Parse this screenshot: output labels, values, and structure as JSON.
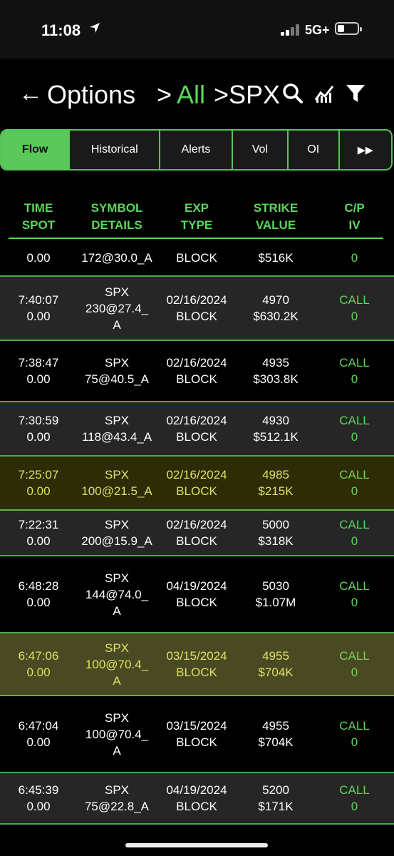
{
  "status_bar": {
    "time": "11:08",
    "network": "5G+"
  },
  "header": {
    "back": "←",
    "crumb1": "Options",
    "sep1": ">",
    "crumb2": "All",
    "sep2": ">SPX"
  },
  "tabs": [
    {
      "label": "Flow",
      "active": true
    },
    {
      "label": "Historical",
      "active": false
    },
    {
      "label": "Alerts",
      "active": false
    },
    {
      "label": "Vol",
      "active": false
    },
    {
      "label": "OI",
      "active": false
    },
    {
      "label": "▸▸",
      "active": false
    }
  ],
  "columns": [
    {
      "line1": "TIME",
      "line2": "SPOT"
    },
    {
      "line1": "SYMBOL",
      "line2": "DETAILS"
    },
    {
      "line1": "EXP",
      "line2": "TYPE"
    },
    {
      "line1": "STRIKE",
      "line2": "VALUE"
    },
    {
      "line1": "C/P",
      "line2": "IV"
    }
  ],
  "rows": [
    {
      "time": "",
      "spot": "0.00",
      "symbol": "",
      "details": "172@30.0_A",
      "exp": "",
      "type": "BLOCK",
      "strike": "",
      "value": "$516K",
      "cp": "",
      "iv": "0",
      "highlight": false
    },
    {
      "time": "7:40:07",
      "spot": "0.00",
      "symbol": "SPX",
      "details": "230@27.4_ A",
      "exp": "02/16/2024",
      "type": "BLOCK",
      "strike": "4970",
      "value": "$630.2K",
      "cp": "CALL",
      "iv": "0",
      "highlight": false
    },
    {
      "time": "7:38:47",
      "spot": "0.00",
      "symbol": "SPX",
      "details": "75@40.5_A",
      "exp": "02/16/2024",
      "type": "BLOCK",
      "strike": "4935",
      "value": "$303.8K",
      "cp": "CALL",
      "iv": "0",
      "highlight": false
    },
    {
      "time": "7:30:59",
      "spot": "0.00",
      "symbol": "SPX",
      "details": "118@43.4_A",
      "exp": "02/16/2024",
      "type": "BLOCK",
      "strike": "4930",
      "value": "$512.1K",
      "cp": "CALL",
      "iv": "0",
      "highlight": false
    },
    {
      "time": "7:25:07",
      "spot": "0.00",
      "symbol": "SPX",
      "details": "100@21.5_A",
      "exp": "02/16/2024",
      "type": "BLOCK",
      "strike": "4985",
      "value": "$215K",
      "cp": "CALL",
      "iv": "0",
      "highlight": true
    },
    {
      "time": "7:22:31",
      "spot": "0.00",
      "symbol": "SPX",
      "details": "200@15.9_A",
      "exp": "02/16/2024",
      "type": "BLOCK",
      "strike": "5000",
      "value": "$318K",
      "cp": "CALL",
      "iv": "0",
      "highlight": false
    },
    {
      "time": "6:48:28",
      "spot": "0.00",
      "symbol": "SPX",
      "details": "144@74.0_ A",
      "exp": "04/19/2024",
      "type": "BLOCK",
      "strike": "5030",
      "value": "$1.07M",
      "cp": "CALL",
      "iv": "0",
      "highlight": false
    },
    {
      "time": "6:47:06",
      "spot": "0.00",
      "symbol": "SPX",
      "details": "100@70.4_ A",
      "exp": "03/15/2024",
      "type": "BLOCK",
      "strike": "4955",
      "value": "$704K",
      "cp": "CALL",
      "iv": "0",
      "highlight": true
    },
    {
      "time": "6:47:04",
      "spot": "0.00",
      "symbol": "SPX",
      "details": "100@70.4_ A",
      "exp": "03/15/2024",
      "type": "BLOCK",
      "strike": "4955",
      "value": "$704K",
      "cp": "CALL",
      "iv": "0",
      "highlight": false
    },
    {
      "time": "6:45:39",
      "spot": "0.00",
      "symbol": "SPX",
      "details": "75@22.8_A",
      "exp": "04/19/2024",
      "type": "BLOCK",
      "strike": "5200",
      "value": "$171K",
      "cp": "CALL",
      "iv": "0",
      "highlight": false
    }
  ],
  "colors": {
    "accent": "#5cd65c",
    "highlight": "#e8e870",
    "background": "#000000"
  }
}
